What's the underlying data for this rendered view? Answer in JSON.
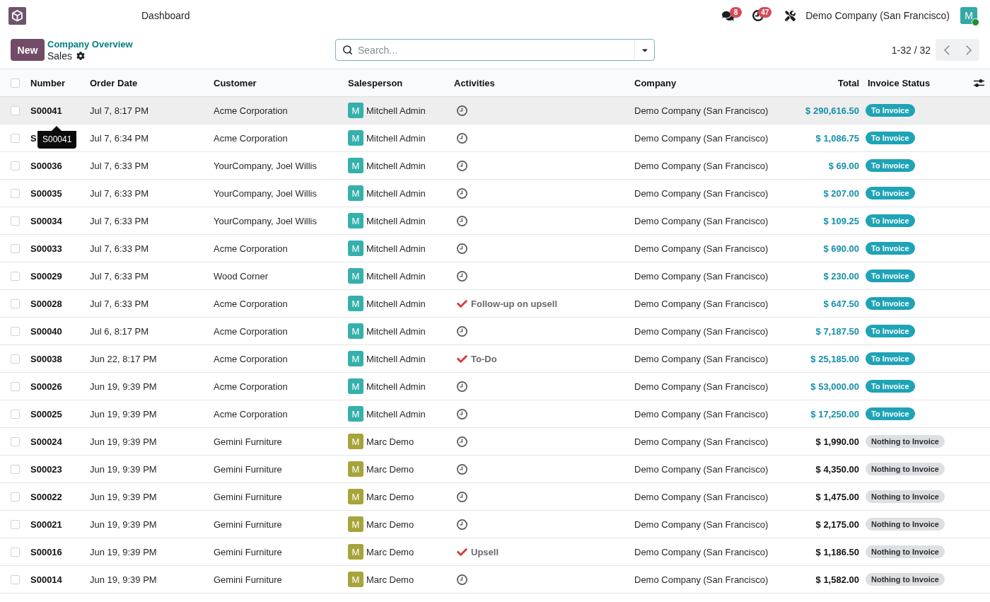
{
  "navbar": {
    "menu": [
      {
        "label": "Dashboard"
      }
    ],
    "messages_count": "8",
    "activities_count": "47",
    "company": "Demo Company (San Francisco)",
    "user": {
      "initial": "M",
      "online": true
    }
  },
  "control_panel": {
    "new_button": "New",
    "breadcrumb": [
      {
        "label": "Company Overview"
      }
    ],
    "title": "Sales",
    "search": {
      "placeholder": "Search..."
    },
    "pager": "1-32 / 32"
  },
  "table": {
    "select_all_checked": false,
    "columns": [
      {
        "label": "Number"
      },
      {
        "label": "Order Date"
      },
      {
        "label": "Customer"
      },
      {
        "label": "Salesperson"
      },
      {
        "label": "Activities"
      },
      {
        "label": "Company"
      },
      {
        "label": "Total"
      },
      {
        "label": "Invoice Status"
      }
    ],
    "rows": [
      {
        "checked": false,
        "hovered": true,
        "number": "S00041",
        "tooltip": "S00041",
        "order_date": "Jul 7, 8:17 PM",
        "customer": "Acme Corporation",
        "salesperson": {
          "initial": "M",
          "name": "Mitchell Admin",
          "color": "#36b0aa"
        },
        "activity": {
          "kind": "clock"
        },
        "company": "Demo Company (San Francisco)",
        "total": "$ 290,616.50",
        "invoice_status": {
          "kind": "to_invoice",
          "label": "To Invoice"
        }
      },
      {
        "checked": false,
        "hovered": false,
        "number": "S",
        "order_date": "Jul 7, 6:34 PM",
        "customer": "Acme Corporation",
        "salesperson": {
          "initial": "M",
          "name": "Mitchell Admin",
          "color": "#36b0aa"
        },
        "activity": {
          "kind": "clock"
        },
        "company": "Demo Company (San Francisco)",
        "total": "$ 1,086.75",
        "invoice_status": {
          "kind": "to_invoice",
          "label": "To Invoice"
        }
      },
      {
        "checked": false,
        "hovered": false,
        "number": "S00036",
        "order_date": "Jul 7, 6:33 PM",
        "customer": "YourCompany, Joel Willis",
        "salesperson": {
          "initial": "M",
          "name": "Mitchell Admin",
          "color": "#36b0aa"
        },
        "activity": {
          "kind": "clock"
        },
        "company": "Demo Company (San Francisco)",
        "total": "$ 69.00",
        "invoice_status": {
          "kind": "to_invoice",
          "label": "To Invoice"
        }
      },
      {
        "checked": false,
        "hovered": false,
        "number": "S00035",
        "order_date": "Jul 7, 6:33 PM",
        "customer": "YourCompany, Joel Willis",
        "salesperson": {
          "initial": "M",
          "name": "Mitchell Admin",
          "color": "#36b0aa"
        },
        "activity": {
          "kind": "clock"
        },
        "company": "Demo Company (San Francisco)",
        "total": "$ 207.00",
        "invoice_status": {
          "kind": "to_invoice",
          "label": "To Invoice"
        }
      },
      {
        "checked": false,
        "hovered": false,
        "number": "S00034",
        "order_date": "Jul 7, 6:33 PM",
        "customer": "YourCompany, Joel Willis",
        "salesperson": {
          "initial": "M",
          "name": "Mitchell Admin",
          "color": "#36b0aa"
        },
        "activity": {
          "kind": "clock"
        },
        "company": "Demo Company (San Francisco)",
        "total": "$ 109.25",
        "invoice_status": {
          "kind": "to_invoice",
          "label": "To Invoice"
        }
      },
      {
        "checked": false,
        "hovered": false,
        "number": "S00033",
        "order_date": "Jul 7, 6:33 PM",
        "customer": "Acme Corporation",
        "salesperson": {
          "initial": "M",
          "name": "Mitchell Admin",
          "color": "#36b0aa"
        },
        "activity": {
          "kind": "clock"
        },
        "company": "Demo Company (San Francisco)",
        "total": "$ 690.00",
        "invoice_status": {
          "kind": "to_invoice",
          "label": "To Invoice"
        }
      },
      {
        "checked": false,
        "hovered": false,
        "number": "S00029",
        "order_date": "Jul 7, 6:33 PM",
        "customer": "Wood Corner",
        "salesperson": {
          "initial": "M",
          "name": "Mitchell Admin",
          "color": "#36b0aa"
        },
        "activity": {
          "kind": "clock"
        },
        "company": "Demo Company (San Francisco)",
        "total": "$ 230.00",
        "invoice_status": {
          "kind": "to_invoice",
          "label": "To Invoice"
        }
      },
      {
        "checked": false,
        "hovered": false,
        "number": "S00028",
        "order_date": "Jul 7, 6:33 PM",
        "customer": "Acme Corporation",
        "salesperson": {
          "initial": "M",
          "name": "Mitchell Admin",
          "color": "#36b0aa"
        },
        "activity": {
          "kind": "done",
          "label": "Follow-up on upsell"
        },
        "company": "Demo Company (San Francisco)",
        "total": "$ 647.50",
        "invoice_status": {
          "kind": "to_invoice",
          "label": "To Invoice"
        }
      },
      {
        "checked": false,
        "hovered": false,
        "number": "S00040",
        "order_date": "Jul 6, 8:17 PM",
        "customer": "Acme Corporation",
        "salesperson": {
          "initial": "M",
          "name": "Mitchell Admin",
          "color": "#36b0aa"
        },
        "activity": {
          "kind": "clock"
        },
        "company": "Demo Company (San Francisco)",
        "total": "$ 7,187.50",
        "invoice_status": {
          "kind": "to_invoice",
          "label": "To Invoice"
        }
      },
      {
        "checked": false,
        "hovered": false,
        "number": "S00038",
        "order_date": "Jun 22, 8:17 PM",
        "customer": "Acme Corporation",
        "salesperson": {
          "initial": "M",
          "name": "Mitchell Admin",
          "color": "#36b0aa"
        },
        "activity": {
          "kind": "done",
          "label": "To-Do"
        },
        "company": "Demo Company (San Francisco)",
        "total": "$ 25,185.00",
        "invoice_status": {
          "kind": "to_invoice",
          "label": "To Invoice"
        }
      },
      {
        "checked": false,
        "hovered": false,
        "number": "S00026",
        "order_date": "Jun 19, 9:39 PM",
        "customer": "Acme Corporation",
        "salesperson": {
          "initial": "M",
          "name": "Mitchell Admin",
          "color": "#36b0aa"
        },
        "activity": {
          "kind": "clock"
        },
        "company": "Demo Company (San Francisco)",
        "total": "$ 53,000.00",
        "invoice_status": {
          "kind": "to_invoice",
          "label": "To Invoice"
        }
      },
      {
        "checked": false,
        "hovered": false,
        "number": "S00025",
        "order_date": "Jun 19, 9:39 PM",
        "customer": "Acme Corporation",
        "salesperson": {
          "initial": "M",
          "name": "Mitchell Admin",
          "color": "#36b0aa"
        },
        "activity": {
          "kind": "clock"
        },
        "company": "Demo Company (San Francisco)",
        "total": "$ 17,250.00",
        "invoice_status": {
          "kind": "to_invoice",
          "label": "To Invoice"
        }
      },
      {
        "checked": false,
        "hovered": false,
        "number": "S00024",
        "order_date": "Jun 19, 9:39 PM",
        "customer": "Gemini Furniture",
        "salesperson": {
          "initial": "M",
          "name": "Marc Demo",
          "color": "#a6a43a"
        },
        "activity": {
          "kind": "clock"
        },
        "company": "Demo Company (San Francisco)",
        "total": "$ 1,990.00",
        "invoice_status": {
          "kind": "nothing",
          "label": "Nothing to Invoice"
        }
      },
      {
        "checked": false,
        "hovered": false,
        "number": "S00023",
        "order_date": "Jun 19, 9:39 PM",
        "customer": "Gemini Furniture",
        "salesperson": {
          "initial": "M",
          "name": "Marc Demo",
          "color": "#a6a43a"
        },
        "activity": {
          "kind": "clock"
        },
        "company": "Demo Company (San Francisco)",
        "total": "$ 4,350.00",
        "invoice_status": {
          "kind": "nothing",
          "label": "Nothing to Invoice"
        }
      },
      {
        "checked": false,
        "hovered": false,
        "number": "S00022",
        "order_date": "Jun 19, 9:39 PM",
        "customer": "Gemini Furniture",
        "salesperson": {
          "initial": "M",
          "name": "Marc Demo",
          "color": "#a6a43a"
        },
        "activity": {
          "kind": "clock"
        },
        "company": "Demo Company (San Francisco)",
        "total": "$ 1,475.00",
        "invoice_status": {
          "kind": "nothing",
          "label": "Nothing to Invoice"
        }
      },
      {
        "checked": false,
        "hovered": false,
        "number": "S00021",
        "order_date": "Jun 19, 9:39 PM",
        "customer": "Gemini Furniture",
        "salesperson": {
          "initial": "M",
          "name": "Marc Demo",
          "color": "#a6a43a"
        },
        "activity": {
          "kind": "clock"
        },
        "company": "Demo Company (San Francisco)",
        "total": "$ 2,175.00",
        "invoice_status": {
          "kind": "nothing",
          "label": "Nothing to Invoice"
        }
      },
      {
        "checked": false,
        "hovered": false,
        "number": "S00016",
        "order_date": "Jun 19, 9:39 PM",
        "customer": "Gemini Furniture",
        "salesperson": {
          "initial": "M",
          "name": "Marc Demo",
          "color": "#a6a43a"
        },
        "activity": {
          "kind": "done",
          "label": "Upsell"
        },
        "company": "Demo Company (San Francisco)",
        "total": "$ 1,186.50",
        "invoice_status": {
          "kind": "nothing",
          "label": "Nothing to Invoice"
        }
      },
      {
        "checked": false,
        "hovered": false,
        "number": "S00014",
        "order_date": "Jun 19, 9:39 PM",
        "customer": "Gemini Furniture",
        "salesperson": {
          "initial": "M",
          "name": "Marc Demo",
          "color": "#a6a43a"
        },
        "activity": {
          "kind": "clock"
        },
        "company": "Demo Company (San Francisco)",
        "total": "$ 1,582.00",
        "invoice_status": {
          "kind": "nothing",
          "label": "Nothing to Invoice"
        }
      }
    ]
  }
}
